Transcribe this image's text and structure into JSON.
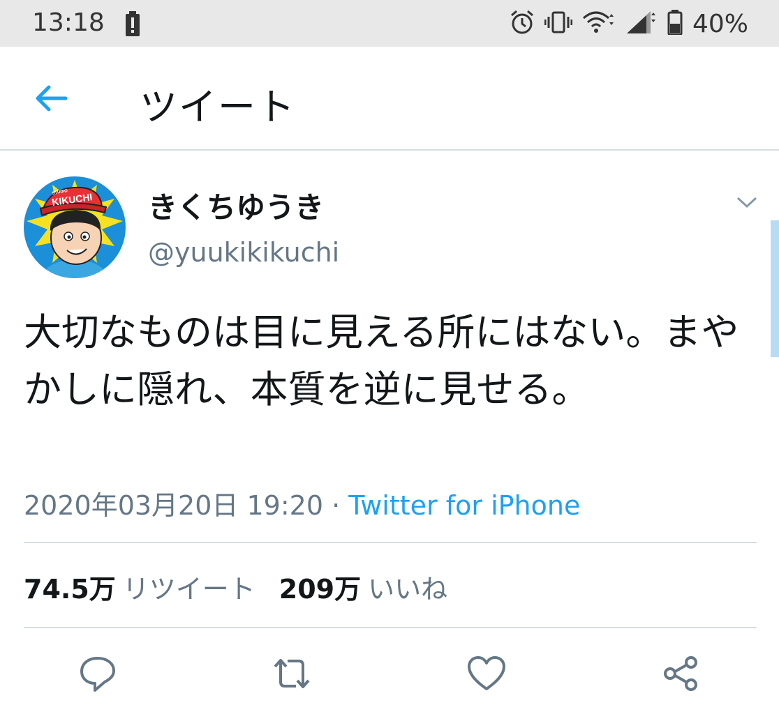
{
  "status_bar": {
    "time": "13:18",
    "battery_percent": "40%",
    "icons": [
      "battery-alert-icon",
      "alarm-icon",
      "vibrate-icon",
      "wifi-icon",
      "signal-icon",
      "battery-icon"
    ]
  },
  "header": {
    "title": "ツイート",
    "back_icon": "back-arrow-icon"
  },
  "tweet": {
    "display_name": "きくちゆうき",
    "handle": "@yuukikikuchi",
    "avatar_badge": "KIKUCHI",
    "avatar_badge_small": "STUDIO",
    "text": "大切なものは目に見える所にはない。まやかしに隠れ、本質を逆に見せる。",
    "timestamp": "2020年03月20日 19:20",
    "separator": "·",
    "source": "Twitter for iPhone",
    "retweet_count": "74.5万",
    "retweet_label": "リツイート",
    "like_count": "209万",
    "like_label": "いいね"
  },
  "actions": [
    "reply-icon",
    "retweet-icon",
    "like-icon",
    "share-icon"
  ],
  "colors": {
    "accent": "#1da1f2",
    "text": "#14171a",
    "secondary": "#657786",
    "divider": "#d6dde3",
    "status_bar_bg": "#e8e8e8"
  }
}
